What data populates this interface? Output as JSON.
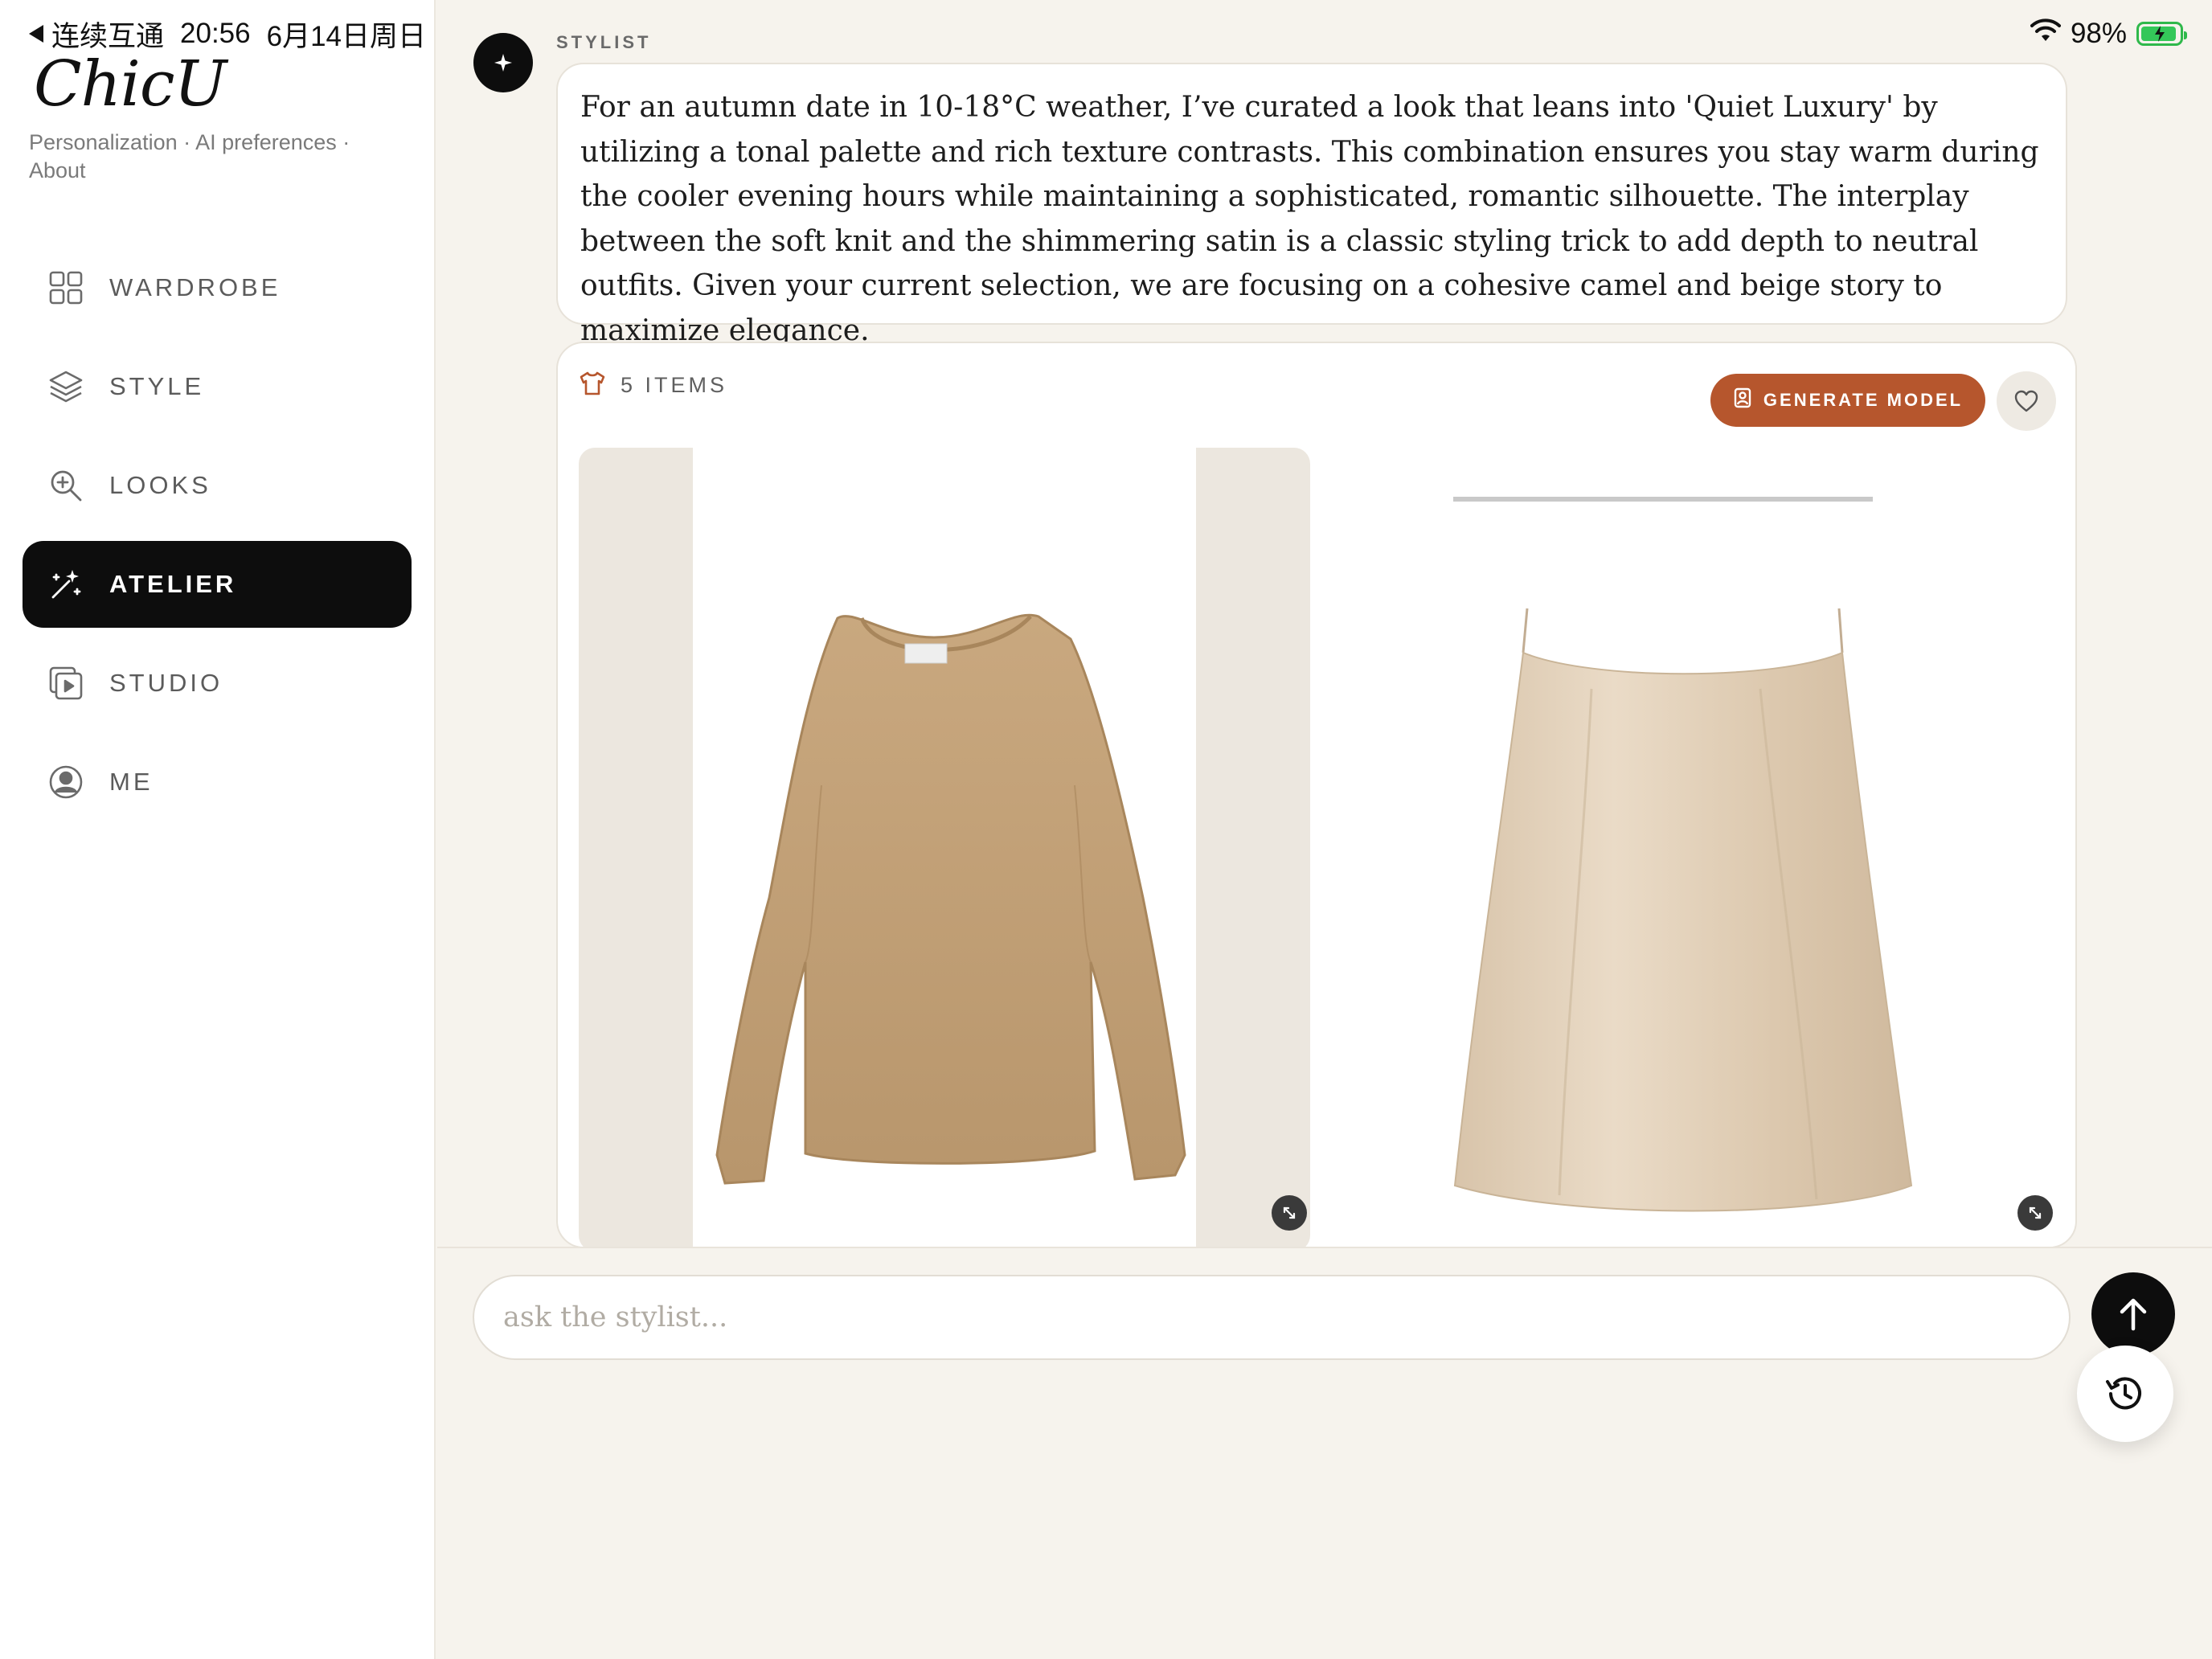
{
  "status_bar": {
    "back_app": "连续互通",
    "time": "20:56",
    "date": "6月14日周日",
    "battery": "98%"
  },
  "sidebar": {
    "brand": "ChicU",
    "links": [
      "Personalization",
      "AI preferences",
      "About"
    ],
    "separator": "·",
    "items": [
      {
        "label": "WARDROBE",
        "icon": "grid-icon",
        "active": false
      },
      {
        "label": "STYLE",
        "icon": "layers-icon",
        "active": false
      },
      {
        "label": "LOOKS",
        "icon": "zoom-icon",
        "active": false
      },
      {
        "label": "ATELIER",
        "icon": "magic-wand-icon",
        "active": true
      },
      {
        "label": "STUDIO",
        "icon": "play-gallery-icon",
        "active": false
      },
      {
        "label": "ME",
        "icon": "user-circle-icon",
        "active": false
      }
    ]
  },
  "chat": {
    "sender": "STYLIST",
    "message": "For an autumn date in 10-18°C weather, I’ve curated a look that leans into 'Quiet Luxury' by utilizing a tonal palette and rich texture contrasts. This combination ensures you stay warm during the cooler evening hours while maintaining a sophisticated, romantic silhouette. The interplay between the soft knit and the shimmering satin is a classic styling trick to add depth to neutral outfits. Given your current selection, we are focusing on a cohesive camel and beige story to maximize elegance.",
    "outfit": {
      "count_label": "5 ITEMS",
      "generate_label": "GENERATE MODEL",
      "items": [
        {
          "name": "camel knit sweater",
          "image": "sweater-image"
        },
        {
          "name": "beige satin slip skirt",
          "image": "skirt-image"
        }
      ]
    }
  },
  "composer": {
    "placeholder": "ask the stylist..."
  },
  "colors": {
    "accent": "#b6562d",
    "active_nav": "#0d0d0d",
    "background": "#f6f3ed",
    "battery": "#34c759"
  }
}
